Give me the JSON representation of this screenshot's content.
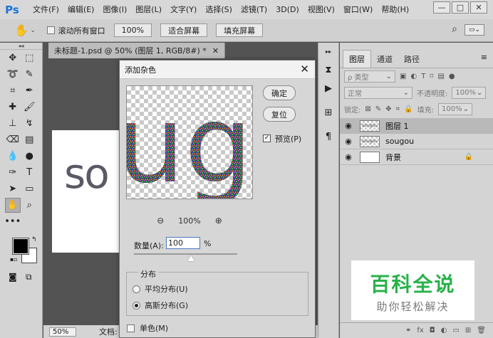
{
  "app": {
    "logo": "Ps"
  },
  "menus": [
    "文件(F)",
    "编辑(E)",
    "图像(I)",
    "图层(L)",
    "文字(Y)",
    "选择(S)",
    "滤镜(T)",
    "3D(D)",
    "视图(V)",
    "窗口(W)",
    "帮助(H)"
  ],
  "window_controls": {
    "minimize": "—",
    "maximize": "□",
    "close": "✕"
  },
  "options_bar": {
    "scroll_all_label": "滚动所有窗口",
    "zoom_value": "100%",
    "fit_screen_label": "适合屏幕",
    "fill_screen_label": "填充屏幕"
  },
  "document": {
    "tab_title": "未标题-1.psd @ 50% (图层 1, RGB/8#) *",
    "canvas_text": "so",
    "status_zoom": "50%",
    "status_doc": "文档:"
  },
  "dialog": {
    "title": "添加杂色",
    "preview_text": "ug",
    "ok_label": "确定",
    "reset_label": "复位",
    "preview_label": "预览(P)",
    "preview_checked": true,
    "preview_zoom": "100%",
    "amount_label": "数量(A):",
    "amount_value": "100",
    "amount_unit": "%",
    "slider_fraction": 0.55,
    "distribution_title": "分布",
    "uniform_label": "平均分布(U)",
    "gaussian_label": "高斯分布(G)",
    "selected_distribution": "gaussian",
    "monochrome_label": "单色(M)",
    "monochrome_checked": false
  },
  "layers_panel": {
    "tabs": [
      "图层",
      "通道",
      "路径"
    ],
    "active_tab": "图层",
    "kind_filter": "ρ 类型",
    "blend_mode": "正常",
    "opacity_label": "不透明度:",
    "opacity_value": "100%",
    "lock_label": "锁定:",
    "fill_label": "填充:",
    "fill_value": "100%",
    "layers": [
      {
        "name": "图层 1",
        "thumb": "sougou",
        "selected": true,
        "locked": false,
        "checker": true
      },
      {
        "name": "sougou",
        "thumb": "sougou",
        "selected": false,
        "locked": false,
        "checker": true
      },
      {
        "name": "背景",
        "thumb": "",
        "selected": false,
        "locked": true,
        "checker": false
      }
    ]
  },
  "watermark": {
    "title": "百科全说",
    "subtitle": "助你轻松解决"
  },
  "colors": {
    "ps_blue": "#1c73d9",
    "watermark_green": "#29b14a"
  }
}
